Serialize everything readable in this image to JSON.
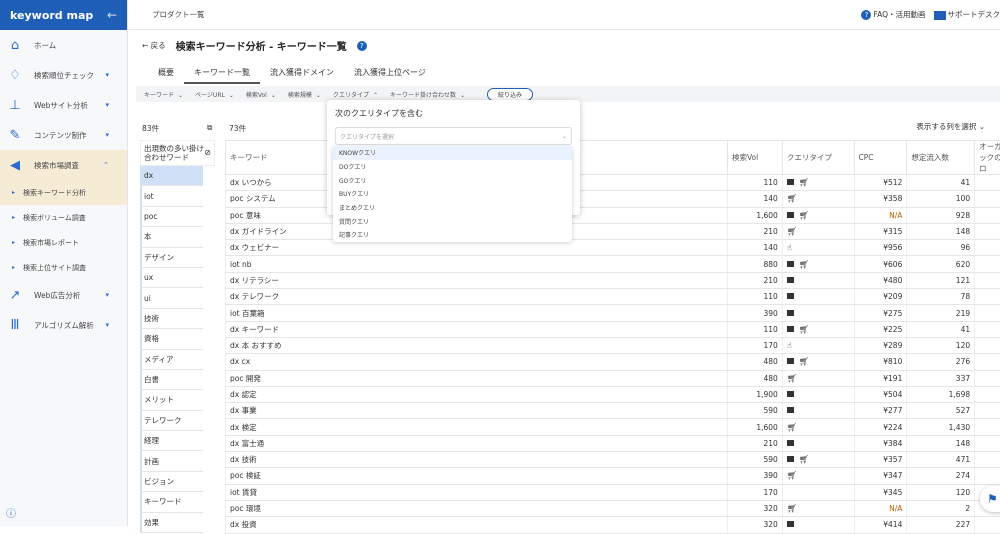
{
  "brand": "keyword map",
  "sidebar": {
    "items": [
      {
        "label": "ホーム",
        "icon": "home-icon"
      },
      {
        "label": "検索順位チェック",
        "icon": "bulb-icon"
      },
      {
        "label": "Webサイト分析",
        "icon": "sitemap-icon"
      },
      {
        "label": "コンテンツ制作",
        "icon": "edit-icon"
      },
      {
        "label": "検索市場調査",
        "icon": "megaphone-icon"
      }
    ],
    "sub": [
      "検索キーワード分析",
      "検索ボリューム調査",
      "検索市場レポート",
      "検索上位サイト調査"
    ],
    "items2": [
      {
        "label": "Web広告分析",
        "icon": "chart-icon"
      },
      {
        "label": "アルゴリズム解析",
        "icon": "algorithm-icon"
      }
    ]
  },
  "topbar": {
    "product_list": "プロダクト一覧",
    "faq": "FAQ・活用動画",
    "support": "サポートデスク"
  },
  "page": {
    "back": "← 戻る",
    "title": "検索キーワード分析 - キーワード一覧"
  },
  "tabs": [
    "概要",
    "キーワード一覧",
    "流入獲得ドメイン",
    "流入獲得上位ページ"
  ],
  "filters": [
    "キーワード",
    "ページURL",
    "検索Vol",
    "検索規模",
    "クエリタイプ",
    "キーワード掛け合わせ数"
  ],
  "filter_button": "絞り込み",
  "left": {
    "count": "83件",
    "header": "出現数の多い掛け合わせワード",
    "words": [
      "dx",
      "iot",
      "poc",
      "本",
      "デザイン",
      "ux",
      "ui",
      "技術",
      "資格",
      "メディア",
      "白書",
      "メリット",
      "テレワーク",
      "経理",
      "計画",
      "ビジョン",
      "キーワード",
      "効果"
    ]
  },
  "table": {
    "count": "73件",
    "column_select": "表示する列を選択",
    "headers": [
      "キーワード",
      "検索Vol",
      "クエリタイプ",
      "CPC",
      "想定流入数",
      "オーガニックのプロ"
    ],
    "rows": [
      [
        "dx いつから",
        "110",
        "bc",
        "¥512",
        "41"
      ],
      [
        "poc システム",
        "140",
        "c",
        "¥358",
        "100"
      ],
      [
        "poc 意味",
        "1,600",
        "bc",
        "N/A",
        "928"
      ],
      [
        "dx ガイドライン",
        "210",
        "c",
        "¥315",
        "148"
      ],
      [
        "dx ウェビナー",
        "140",
        "h",
        "¥956",
        "96"
      ],
      [
        "iot nb",
        "880",
        "bc",
        "¥606",
        "620"
      ],
      [
        "dx リテラシー",
        "210",
        "b",
        "¥480",
        "121"
      ],
      [
        "dx テレワーク",
        "110",
        "b",
        "¥209",
        "78"
      ],
      [
        "iot 百葉箱",
        "390",
        "b",
        "¥275",
        "219"
      ],
      [
        "dx キーワード",
        "110",
        "bc",
        "¥225",
        "41"
      ],
      [
        "dx 本 おすすめ",
        "170",
        "h",
        "¥289",
        "120"
      ],
      [
        "dx cx",
        "480",
        "bc",
        "¥810",
        "276"
      ],
      [
        "poc 開発",
        "480",
        "c",
        "¥191",
        "337"
      ],
      [
        "dx 認定",
        "1,900",
        "b",
        "¥504",
        "1,698"
      ],
      [
        "dx 事業",
        "590",
        "b",
        "¥277",
        "527"
      ],
      [
        "dx 検定",
        "1,600",
        "c",
        "¥224",
        "1,430"
      ],
      [
        "dx 富士通",
        "210",
        "b",
        "¥384",
        "148"
      ],
      [
        "dx 技術",
        "590",
        "bc",
        "¥357",
        "471"
      ],
      [
        "poc 検証",
        "390",
        "c",
        "¥347",
        "274"
      ],
      [
        "iot 賃貸",
        "170",
        "",
        "¥345",
        "120"
      ],
      [
        "poc 環境",
        "320",
        "c",
        "N/A",
        "2"
      ],
      [
        "dx 投資",
        "320",
        "b",
        "¥414",
        "227"
      ]
    ]
  },
  "popup": {
    "title": "次のクエリタイプを含む",
    "placeholder": "クエリタイプを選択",
    "options": [
      "KNOWクエリ",
      "DOクエリ",
      "GOクエリ",
      "BUYクエリ",
      "まとめクエリ",
      "質問クエリ",
      "記事クエリ"
    ]
  }
}
